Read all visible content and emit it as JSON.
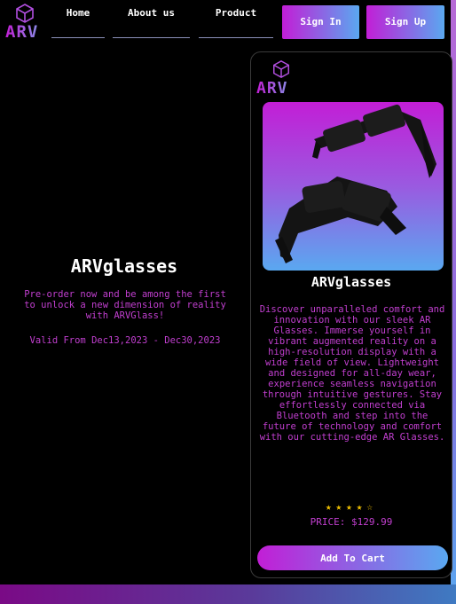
{
  "header": {
    "logo_text": "ARV",
    "nav": [
      "Home",
      "About us",
      "Product"
    ],
    "signin_label": "Sign In",
    "signup_label": "Sign Up"
  },
  "promo": {
    "title": "ARVglasses",
    "text": "Pre-order now and be among the first to unlock a new dimension of reality with ARVGlass!",
    "valid": "Valid From Dec13,2023 - Dec30,2023"
  },
  "product": {
    "logo_text": "ARV",
    "title": "ARVglasses",
    "description": "Discover unparalleled comfort and innovation with our sleek AR Glasses. Immerse yourself in vibrant augmented reality on a high-resolution display with a wide field of view. Lightweight and designed for all-day wear, experience seamless navigation through intuitive gestures. Stay effortlessly connected via Bluetooth and step into the future of technology and comfort with our cutting-edge AR Glasses.",
    "rating": 4.5,
    "rating_max": 5,
    "stars": "★★★★☆",
    "price": "PRICE: $129.99",
    "cart_label": "Add To Cart"
  },
  "colors": {
    "accent_magenta": "#c21ed6",
    "accent_blue": "#5aa8f0",
    "text_magenta": "#c23fd0",
    "star": "#f0c000"
  }
}
